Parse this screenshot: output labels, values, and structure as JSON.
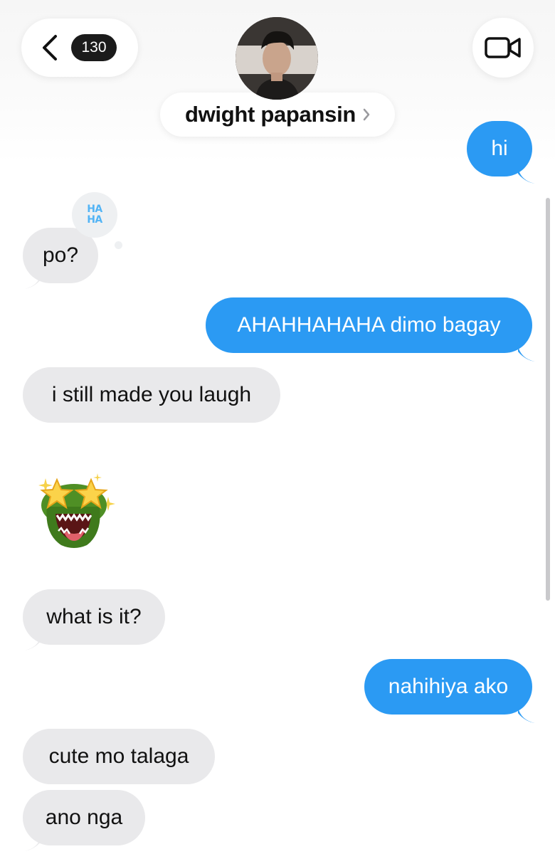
{
  "header": {
    "back_count": "130",
    "contact_name": "dwight papansin"
  },
  "messages": [
    {
      "id": "m1",
      "from": "me",
      "text": "hi"
    },
    {
      "id": "m2",
      "from": "them",
      "text": "po?",
      "tapback": {
        "top": "HA",
        "bottom": "HA"
      }
    },
    {
      "id": "m3",
      "from": "me",
      "text": "AHAHHAHAHA dimo bagay"
    },
    {
      "id": "m4",
      "from": "them",
      "text": "i still made you laugh"
    },
    {
      "id": "m5",
      "from": "them",
      "type": "memoji",
      "icon": "crocodile-star-eyes-memoji"
    },
    {
      "id": "m6",
      "from": "them",
      "text": "what is it?"
    },
    {
      "id": "m7",
      "from": "me",
      "text": "nahihiya ako"
    },
    {
      "id": "m8",
      "from": "them",
      "text": "cute mo talaga"
    },
    {
      "id": "m9",
      "from": "them",
      "text": "ano nga"
    }
  ],
  "colors": {
    "sent_bubble": "#2b9af3",
    "received_bubble": "#e9e9eb",
    "badge": "#1b1b1b"
  }
}
